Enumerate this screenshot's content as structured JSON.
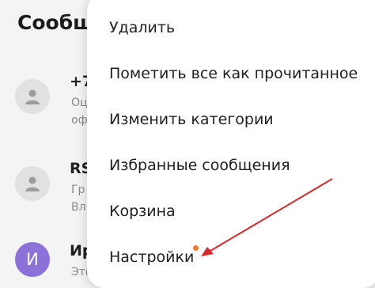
{
  "header": {
    "title": "Сообщ"
  },
  "messages": [
    {
      "sender": "+7",
      "lines": [
        "Оц",
        "оф"
      ]
    },
    {
      "sender": "RS",
      "lines": [
        "Гр",
        "Вл"
      ]
    },
    {
      "avatar_letter": "И",
      "sender": "Ир",
      "lines": [
        "Это"
      ]
    }
  ],
  "menu": {
    "items": [
      {
        "label": "Удалить"
      },
      {
        "label": "Пометить все как прочитанное"
      },
      {
        "label": "Изменить категории"
      },
      {
        "label": "Избранные сообщения"
      },
      {
        "label": "Корзина"
      },
      {
        "label": "Настройки"
      }
    ]
  },
  "annotation": {
    "arrow_color": "#d42a2a",
    "dot_color": "#f07a2c"
  },
  "colors": {
    "avatar_purple": "#8b72d8",
    "avatar_gray": "#e1e1e1"
  }
}
